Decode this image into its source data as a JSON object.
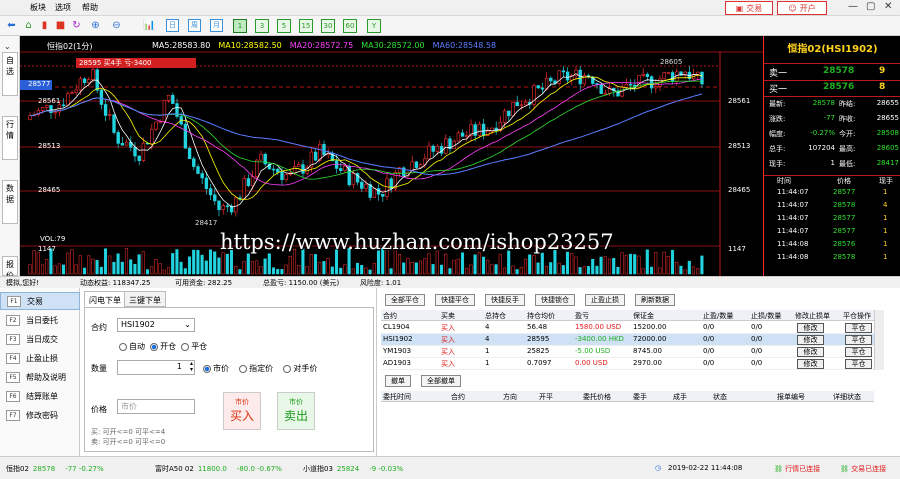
{
  "menu": [
    "板块",
    "选项",
    "帮助"
  ],
  "header": {
    "trade_label": "交易",
    "open_label": "开户"
  },
  "toolbar": {
    "periods": [
      "1",
      "3",
      "5",
      "15",
      "30",
      "60",
      "Y"
    ],
    "selected_period": "1",
    "boxes": [
      "日",
      "周",
      "月"
    ]
  },
  "sidetabs": [
    "自选",
    "行情",
    "数据",
    "报价"
  ],
  "chart": {
    "title": "恒指02(1分)",
    "ma": [
      {
        "label": "MA5:28583.80",
        "color": "#ffffff"
      },
      {
        "label": "MA10:28582.50",
        "color": "#ffff00"
      },
      {
        "label": "MA20:28572.75",
        "color": "#ff40ff"
      },
      {
        "label": "MA30:28572.00",
        "color": "#2ee02e"
      },
      {
        "label": "MA60:28548.58",
        "color": "#5a7dff"
      }
    ],
    "position_tag": "28595 买4手 亏-3400",
    "price_tag": "28577",
    "y_ticks": [
      "28561",
      "28513",
      "28465"
    ],
    "right_ticks": [
      "28561",
      "28513",
      "28465"
    ],
    "vol_label": "VOL:79",
    "vol_tick": "1147",
    "high_label": "28605",
    "low_label": "28417"
  },
  "chart_data": {
    "type": "candlestick",
    "title": "恒指02(1分)",
    "ylim": [
      28417,
      28605
    ],
    "ma_values": {
      "MA5": 28583.8,
      "MA10": 28582.5,
      "MA20": 28572.75,
      "MA30": 28572.0,
      "MA60": 28548.58
    }
  },
  "quote": {
    "title": "恒指02(HSI1902)",
    "ask": {
      "label": "卖一",
      "price": "28578",
      "qty": "9"
    },
    "bid": {
      "label": "买一",
      "price": "28576",
      "qty": "8"
    },
    "stats": [
      {
        "l1": "最新:",
        "v1": "28578",
        "c1": "dn",
        "l2": "昨结:",
        "v2": "28655",
        "c2": "w"
      },
      {
        "l1": "涨跌:",
        "v1": "-77",
        "c1": "dn",
        "l2": "昨收:",
        "v2": "28655",
        "c2": "w"
      },
      {
        "l1": "幅度:",
        "v1": "-0.27%",
        "c1": "dn",
        "l2": "今开:",
        "v2": "28508",
        "c2": "dn"
      },
      {
        "l1": "总手:",
        "v1": "107204",
        "c1": "w",
        "l2": "最高:",
        "v2": "28605",
        "c2": "dn"
      },
      {
        "l1": "现手:",
        "v1": "1",
        "c1": "w",
        "l2": "最低:",
        "v2": "28417",
        "c2": "dn"
      }
    ],
    "tick_head": {
      "time": "时间",
      "price": "价格",
      "vol": "现手"
    },
    "ticks": [
      {
        "time": "11:44:07",
        "price": "28577",
        "vol": "1"
      },
      {
        "time": "11:44:07",
        "price": "28578",
        "vol": "4"
      },
      {
        "time": "11:44:07",
        "price": "28577",
        "vol": "1"
      },
      {
        "time": "11:44:07",
        "price": "28577",
        "vol": "1"
      },
      {
        "time": "11:44:08",
        "price": "28576",
        "vol": "1"
      },
      {
        "time": "11:44:08",
        "price": "28578",
        "vol": "1"
      }
    ]
  },
  "status": {
    "user": "模拟,您好!",
    "equity": "动态权益: 118347.25",
    "available": "可用资金: 282.25",
    "margin": "总盈亏: 1150.00 (美元)",
    "risk": "风险度: 1.01"
  },
  "nav": [
    {
      "key": "F1",
      "label": "交易"
    },
    {
      "key": "F2",
      "label": "当日委托"
    },
    {
      "key": "F3",
      "label": "当日成交"
    },
    {
      "key": "F4",
      "label": "止盈止损"
    },
    {
      "key": "F5",
      "label": "帮助及说明"
    },
    {
      "key": "F6",
      "label": "结算账单"
    },
    {
      "key": "F7",
      "label": "修改密码"
    }
  ],
  "order": {
    "tabs": [
      "闪电下单",
      "三键下单"
    ],
    "contract_label": "合约",
    "contract": "HSI1902",
    "open_opts": [
      "自动",
      "开仓",
      "平仓"
    ],
    "qty_label": "数量",
    "qty": "1",
    "price_opts": [
      "市价",
      "指定价",
      "对手价"
    ],
    "price_label": "价格",
    "price_ph": "市价",
    "buy_top": "市价",
    "buy_label": "买入",
    "sell_top": "市价",
    "sell_label": "卖出",
    "hint1": "买: 可开<=0 可平<=4",
    "hint2": "卖: 可开<=0 可平<=0"
  },
  "positions": {
    "actions": [
      "全部平仓",
      "快捷平仓",
      "快捷反手",
      "快捷锁仓",
      "止盈止损",
      "刷新数据"
    ],
    "headers": [
      "合约",
      "买卖",
      "总持仓",
      "持仓均价",
      "盈亏",
      "保证金",
      "止盈/数量",
      "止损/数量",
      "修改止损单",
      "平仓操作"
    ],
    "rows": [
      [
        "CL1904",
        "买入",
        "4",
        "56.48",
        "1580.00 USD",
        "15200.00",
        "0/0",
        "0/0",
        "修改",
        "平仓"
      ],
      [
        "HSI1902",
        "买入",
        "4",
        "28595",
        "-3400.00 HKD",
        "72000.00",
        "0/0",
        "0/0",
        "修改",
        "平仓"
      ],
      [
        "YM1903",
        "买入",
        "1",
        "25825",
        "-5.00 USD",
        "8745.00",
        "0/0",
        "0/0",
        "修改",
        "平仓"
      ],
      [
        "AD1903",
        "买入",
        "1",
        "0.7097",
        "0.00 USD",
        "2970.00",
        "0/0",
        "0/0",
        "修改",
        "平仓"
      ]
    ],
    "sub_actions": [
      "撤单",
      "全部撤单"
    ],
    "order_headers": [
      "委托时间",
      "合约",
      "方向",
      "开平",
      "委托价格",
      "委手",
      "成手",
      "状态",
      "报单编号",
      "详细状态"
    ]
  },
  "bottom": {
    "items": [
      {
        "name": "恒指02",
        "price": "28578",
        "chg": "-77 -0.27%"
      },
      {
        "name": "富时A50 02",
        "price": "11800.0",
        "chg": "-80.0 -0.67%"
      },
      {
        "name": "小道指03",
        "price": "25824",
        "chg": "-9 -0.03%"
      }
    ],
    "clock": "2019-02-22 11:44:08",
    "conn1": "行情已连接",
    "conn2": "交易已连接"
  },
  "watermark": "https://www.huzhan.com/ishop23257"
}
